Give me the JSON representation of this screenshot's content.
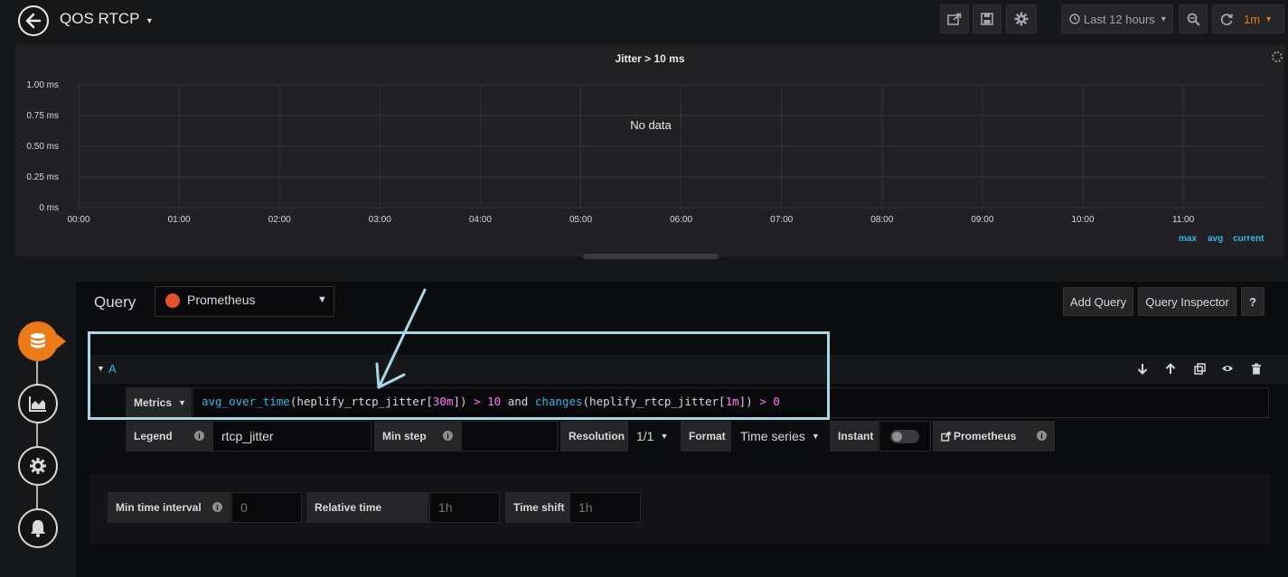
{
  "header": {
    "title": "QOS RTCP",
    "time_range": "Last 12 hours",
    "refresh": "1m"
  },
  "panel": {
    "title": "Jitter > 10 ms",
    "no_data": "No data",
    "legend": [
      "max",
      "avg",
      "current"
    ]
  },
  "chart_data": {
    "type": "line",
    "title": "Jitter > 10 ms",
    "y_ticks": [
      "1.00 ms",
      "0.75 ms",
      "0.50 ms",
      "0.25 ms",
      "0 ms"
    ],
    "x_ticks": [
      "00:00",
      "01:00",
      "02:00",
      "03:00",
      "04:00",
      "05:00",
      "06:00",
      "07:00",
      "08:00",
      "09:00",
      "10:00",
      "11:00"
    ],
    "ylim": [
      0,
      1
    ],
    "series": [],
    "grid": true
  },
  "editor": {
    "query_label": "Query",
    "datasource": "Prometheus",
    "add_query": "Add Query",
    "query_inspector": "Query Inspector",
    "help": "?"
  },
  "query_a": {
    "ref": "A",
    "metrics_label": "Metrics",
    "expression_tokens": [
      {
        "t": "avg_over_time",
        "c": "c-fn"
      },
      {
        "t": "(",
        "c": "c-p"
      },
      {
        "t": "heplify_rtcp_jitter",
        "c": "c-p"
      },
      {
        "t": "[",
        "c": "c-p"
      },
      {
        "t": "30m",
        "c": "c-num"
      },
      {
        "t": "])",
        "c": "c-p"
      },
      {
        "t": " > ",
        "c": "c-op"
      },
      {
        "t": "10",
        "c": "c-num"
      },
      {
        "t": " and ",
        "c": "c-kw"
      },
      {
        "t": "changes",
        "c": "c-fn"
      },
      {
        "t": "(",
        "c": "c-p"
      },
      {
        "t": "heplify_rtcp_jitter",
        "c": "c-p"
      },
      {
        "t": "[",
        "c": "c-p"
      },
      {
        "t": "1m",
        "c": "c-num"
      },
      {
        "t": "])",
        "c": "c-p"
      },
      {
        "t": " > ",
        "c": "c-op"
      },
      {
        "t": "0",
        "c": "c-num"
      }
    ],
    "legend_label": "Legend",
    "legend_value": "rtcp_jitter",
    "min_step_label": "Min step",
    "min_step_value": "",
    "resolution_label": "Resolution",
    "resolution_value": "1/1",
    "format_label": "Format",
    "format_value": "Time series",
    "instant_label": "Instant",
    "instant_on": false,
    "prometheus_link": "Prometheus"
  },
  "options": {
    "min_interval_label": "Min time interval",
    "min_interval_placeholder": "0",
    "relative_time_label": "Relative time",
    "relative_time_placeholder": "1h",
    "time_shift_label": "Time shift",
    "time_shift_placeholder": "1h"
  }
}
